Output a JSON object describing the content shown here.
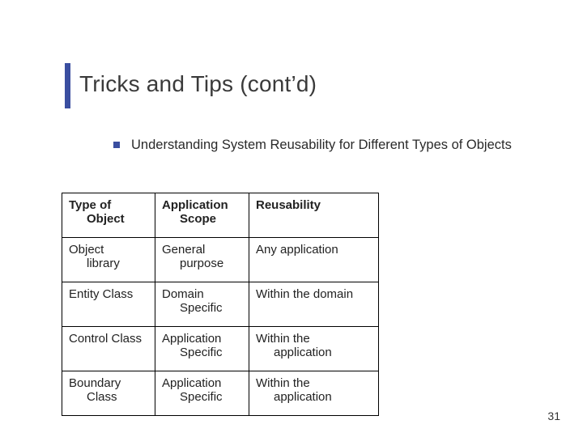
{
  "title": "Tricks and Tips (cont’d)",
  "bullet": "Understanding System Reusability for Different Types of Objects",
  "table": {
    "headers": {
      "c1a": "Type of",
      "c1b": "Object",
      "c2a": "Application",
      "c2b": "Scope",
      "c3": "Reusability"
    },
    "rows": [
      {
        "c1a": "Object",
        "c1b": "library",
        "c2a": "General",
        "c2b": "purpose",
        "c3a": "Any application",
        "c3b": ""
      },
      {
        "c1a": "Entity Class",
        "c1b": "",
        "c2a": "Domain",
        "c2b": "Specific",
        "c3a": "Within the domain",
        "c3b": ""
      },
      {
        "c1a": "Control Class",
        "c1b": "",
        "c2a": "Application",
        "c2b": "Specific",
        "c3a": "Within the",
        "c3b": "application"
      },
      {
        "c1a": "Boundary",
        "c1b": "Class",
        "c2a": "Application",
        "c2b": "Specific",
        "c3a": "Within the",
        "c3b": "application"
      }
    ]
  },
  "slide_number": "31"
}
